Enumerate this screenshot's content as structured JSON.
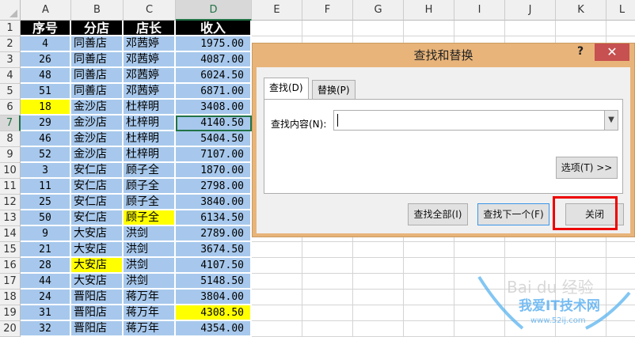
{
  "columns": [
    "A",
    "B",
    "C",
    "D",
    "E",
    "F",
    "G",
    "H",
    "I",
    "J",
    "K",
    "L"
  ],
  "header_row": [
    "序号",
    "分店",
    "店长",
    "收入"
  ],
  "rows": [
    [
      "4",
      "同善店",
      "邓茜婷",
      "1975.00"
    ],
    [
      "26",
      "同善店",
      "邓茜婷",
      "4087.00"
    ],
    [
      "48",
      "同善店",
      "邓茜婷",
      "6024.50"
    ],
    [
      "51",
      "同善店",
      "邓茜婷",
      "6871.00"
    ],
    [
      "18",
      "金沙店",
      "杜梓明",
      "3408.00"
    ],
    [
      "29",
      "金沙店",
      "杜梓明",
      "4140.50"
    ],
    [
      "46",
      "金沙店",
      "杜梓明",
      "5404.50"
    ],
    [
      "52",
      "金沙店",
      "杜梓明",
      "7107.00"
    ],
    [
      "3",
      "安仁店",
      "顾子全",
      "1870.00"
    ],
    [
      "11",
      "安仁店",
      "顾子全",
      "2798.00"
    ],
    [
      "25",
      "安仁店",
      "顾子全",
      "3840.00"
    ],
    [
      "50",
      "安仁店",
      "顾子全",
      "6134.50"
    ],
    [
      "9",
      "大安店",
      "洪剑",
      "2789.00"
    ],
    [
      "21",
      "大安店",
      "洪剑",
      "3674.50"
    ],
    [
      "28",
      "大安店",
      "洪剑",
      "4107.50"
    ],
    [
      "44",
      "大安店",
      "洪剑",
      "5148.50"
    ],
    [
      "24",
      "晋阳店",
      "蒋万年",
      "3804.00"
    ],
    [
      "31",
      "晋阳店",
      "蒋万年",
      "4308.50"
    ],
    [
      "32",
      "晋阳店",
      "蒋万年",
      "4354.00"
    ]
  ],
  "highlighted_cells": [
    "A6",
    "C13",
    "B16",
    "D19"
  ],
  "active_cell": "D7",
  "colors": {
    "data_fill": "#a7c8ec",
    "highlight": "#ffff00",
    "header_fill": "#000000",
    "dialog_frame": "#e8b47a",
    "close_red": "#c75050"
  },
  "dialog": {
    "title": "查找和替换",
    "help": "?",
    "close": "✕",
    "tabs": [
      "查找(D)",
      "替换(P)"
    ],
    "find_label": "查找内容(N):",
    "find_value": "",
    "options_button": "选项(T) >>",
    "find_all": "查找全部(I)",
    "find_next": "查找下一个(F)",
    "close_button": "关闭"
  },
  "watermark": {
    "line1": "Bai du 经验",
    "line2": "我爱IT技术网",
    "line3": "www.52ij.com"
  }
}
